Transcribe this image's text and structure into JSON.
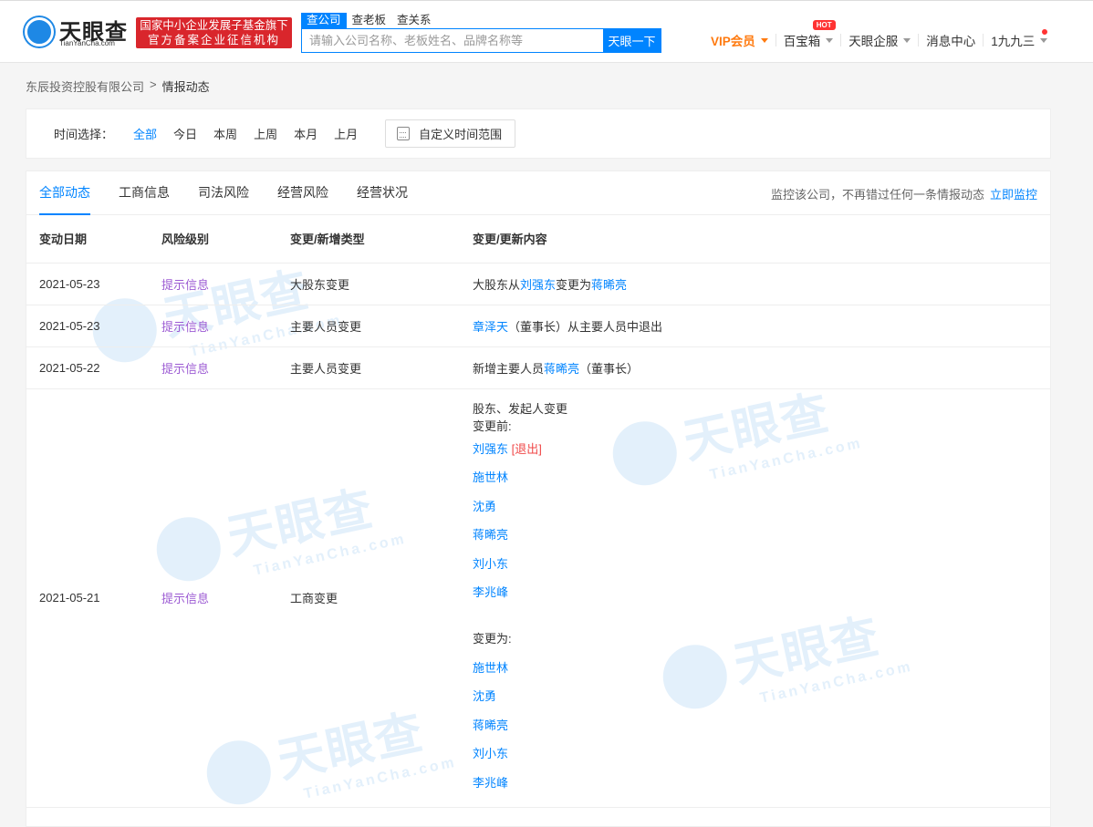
{
  "header": {
    "logo_name": "天眼查",
    "logo_domain": "TianYanCha.com",
    "promo_line1": "国家中小企业发展子基金旗下",
    "promo_line2": "官方备案企业征信机构",
    "search_tabs": [
      "查公司",
      "查老板",
      "查关系"
    ],
    "search_placeholder": "请输入公司名称、老板姓名、品牌名称等",
    "search_button": "天眼一下",
    "nav": {
      "vip": "VIP会员",
      "treasure": "百宝箱",
      "hot_badge": "HOT",
      "enterprise": "天眼企服",
      "messages": "消息中心",
      "user": "1九九三"
    }
  },
  "breadcrumb": {
    "company": "东辰投资控股有限公司",
    "current": "情报动态"
  },
  "filter": {
    "label": "时间选择：",
    "options": [
      "全部",
      "今日",
      "本周",
      "上周",
      "本月",
      "上月"
    ],
    "selected": "全部",
    "custom": "自定义时间范围"
  },
  "tabs": [
    "全部动态",
    "工商信息",
    "司法风险",
    "经营风险",
    "经营状况"
  ],
  "active_tab": "全部动态",
  "monitor": {
    "text": "监控该公司，不再错过任何一条情报动态",
    "link": "立即监控"
  },
  "table": {
    "headers": [
      "变动日期",
      "风险级别",
      "变更/新增类型",
      "变更/更新内容"
    ],
    "rows": [
      {
        "date": "2021-05-23",
        "risk": "提示信息",
        "type": "大股东变更",
        "c": [
          "大股东从",
          "刘强东",
          "变更为",
          "蒋晞亮"
        ]
      },
      {
        "date": "2021-05-23",
        "risk": "提示信息",
        "type": "主要人员变更",
        "c": [
          "章泽天",
          "（董事长）从主要人员中退出"
        ]
      },
      {
        "date": "2021-05-22",
        "risk": "提示信息",
        "type": "主要人员变更",
        "c": [
          "新增主要人员",
          "蒋晞亮",
          "（董事长）"
        ]
      },
      {
        "date": "2021-05-21",
        "risk": "提示信息",
        "type": "工商变更",
        "title": "股东、发起人变更",
        "before_label": "变更前:",
        "before": [
          "刘强东",
          "施世林",
          "沈勇",
          "蒋晞亮",
          "刘小东",
          "李兆峰"
        ],
        "exit_tag": "[退出]",
        "after_label": "变更为:",
        "after": [
          "施世林",
          "沈勇",
          "蒋晞亮",
          "刘小东",
          "李兆峰"
        ]
      }
    ]
  },
  "watermark": {
    "name": "天眼查",
    "domain": "TianYanCha.com"
  },
  "colors": {
    "accent": "#0084ff",
    "risk": "#9c5bd3",
    "exit": "#f04848",
    "vip": "#ff7a0f",
    "promo": "#d9262c"
  }
}
